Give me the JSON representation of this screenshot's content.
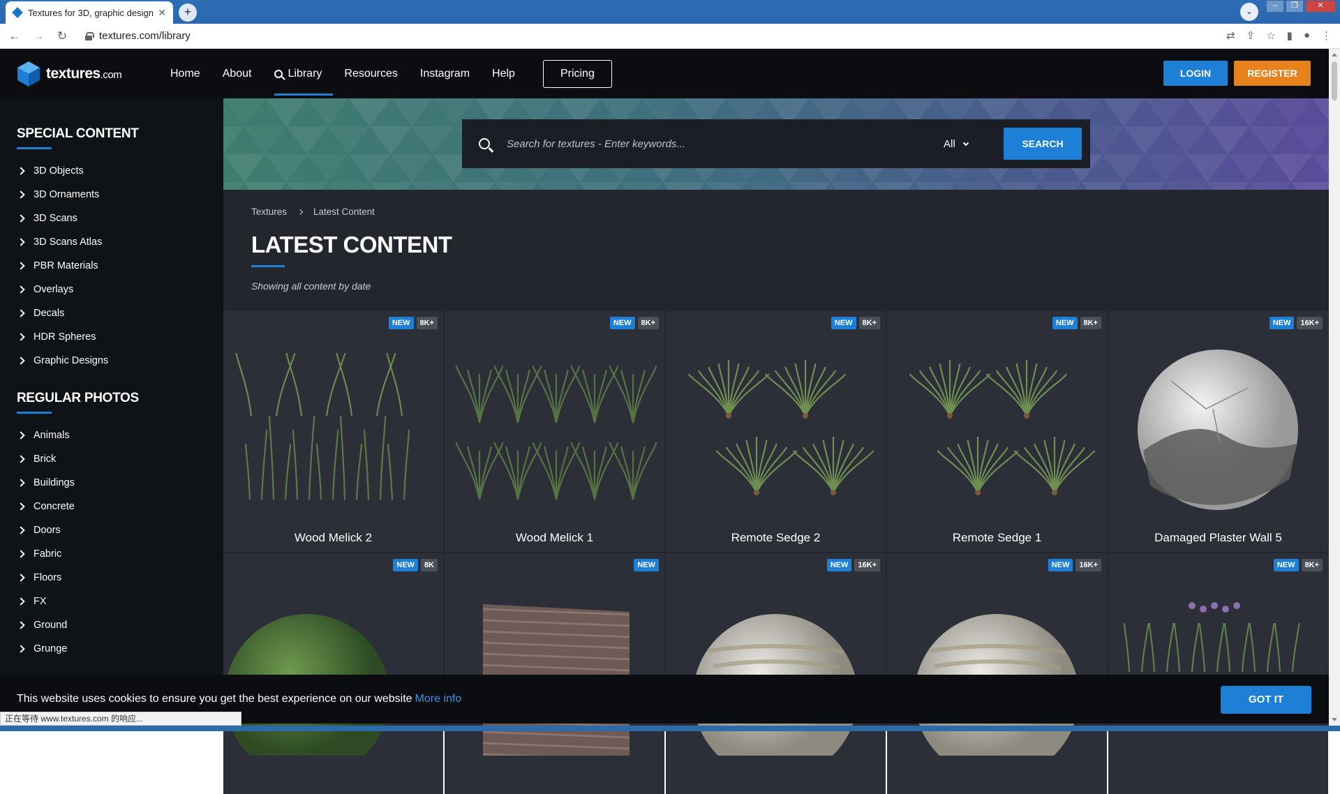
{
  "browser": {
    "tab_title": "Textures for 3D, graphic design",
    "url": "textures.com/library",
    "status_text": "正在等待 www.textures.com 的响应..."
  },
  "header": {
    "logo_text": "textures",
    "logo_suffix": ".com",
    "nav": [
      "Home",
      "About",
      "Library",
      "Resources",
      "Instagram",
      "Help"
    ],
    "active_nav": "Library",
    "pricing_label": "Pricing",
    "login_label": "LOGIN",
    "register_label": "REGISTER"
  },
  "sidebar": {
    "special_heading": "SPECIAL CONTENT",
    "special_items": [
      "3D Objects",
      "3D Ornaments",
      "3D Scans",
      "3D Scans Atlas",
      "PBR Materials",
      "Overlays",
      "Decals",
      "HDR Spheres",
      "Graphic Designs"
    ],
    "regular_heading": "REGULAR PHOTOS",
    "regular_items": [
      "Animals",
      "Brick",
      "Buildings",
      "Concrete",
      "Doors",
      "Fabric",
      "Floors",
      "FX",
      "Ground",
      "Grunge"
    ]
  },
  "search": {
    "placeholder": "Search for textures - Enter keywords...",
    "scope": "All",
    "button_label": "SEARCH"
  },
  "main": {
    "breadcrumb": [
      "Textures",
      "Latest Content"
    ],
    "title": "LATEST CONTENT",
    "subtitle": "Showing all content by date"
  },
  "cards": [
    {
      "name": "Wood Melick 2",
      "new": "NEW",
      "res": "8K+",
      "thumb": "grass-blades"
    },
    {
      "name": "Wood Melick 1",
      "new": "NEW",
      "res": "8K+",
      "thumb": "grass-plants"
    },
    {
      "name": "Remote Sedge 2",
      "new": "NEW",
      "res": "8K+",
      "thumb": "sedge"
    },
    {
      "name": "Remote Sedge 1",
      "new": "NEW",
      "res": "8K+",
      "thumb": "sedge"
    },
    {
      "name": "Damaged Plaster Wall 5",
      "new": "NEW",
      "res": "16K+",
      "thumb": "plaster-sphere"
    },
    {
      "name": "",
      "new": "NEW",
      "res": "8K",
      "thumb": "moss-sphere"
    },
    {
      "name": "",
      "new": "NEW",
      "res": "",
      "thumb": "brick-panel"
    },
    {
      "name": "",
      "new": "NEW",
      "res": "16K+",
      "thumb": "stone-sphere"
    },
    {
      "name": "",
      "new": "NEW",
      "res": "16K+",
      "thumb": "stone-sphere"
    },
    {
      "name": "",
      "new": "NEW",
      "res": "8K+",
      "thumb": "flowers"
    }
  ],
  "cookie": {
    "text": "This website uses cookies to ensure you get the best experience on our website",
    "link": "More info",
    "button": "GOT IT"
  },
  "colors": {
    "accent": "#1d7fd6",
    "register": "#e6831f",
    "page_bg": "#23262d",
    "card_bg": "#2c2f37"
  }
}
